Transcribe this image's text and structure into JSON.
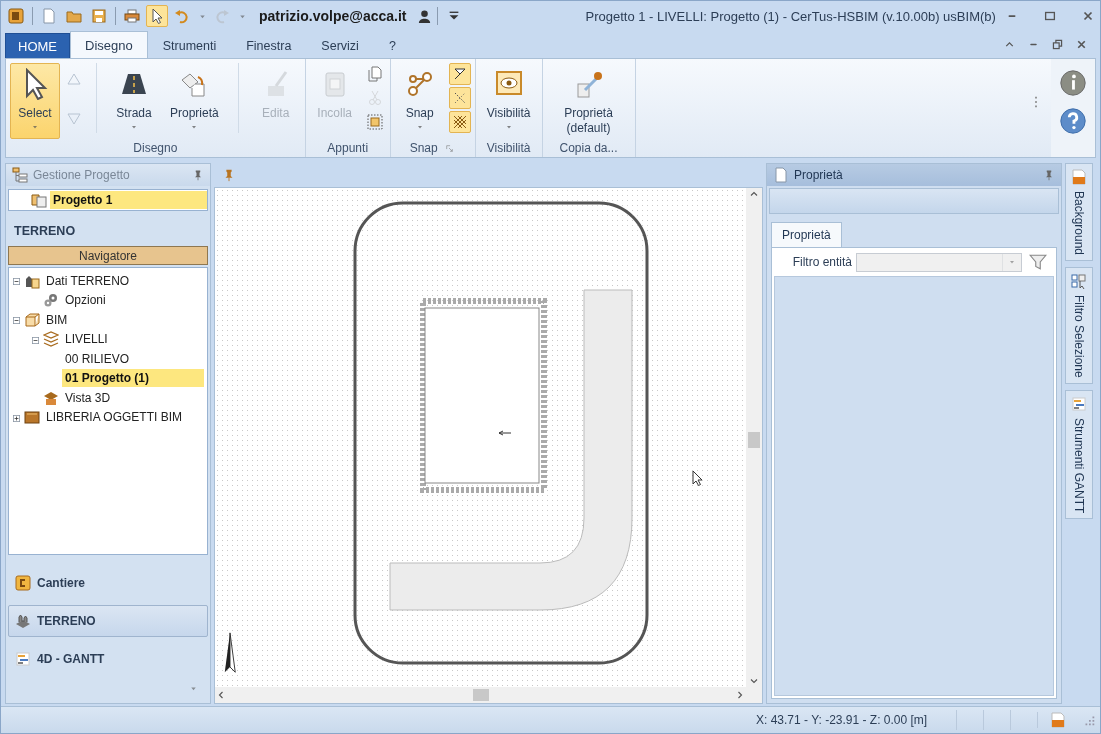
{
  "quick_access": {
    "buttons": [
      {
        "selected": false,
        "disabled": false
      },
      {
        "selected": false,
        "disabled": false
      },
      {
        "selected": false,
        "disabled": false
      },
      {
        "selected": false,
        "disabled": false
      },
      {
        "selected": false,
        "disabled": false
      },
      {
        "selected": true,
        "disabled": false
      },
      {
        "selected": false,
        "disabled": false
      },
      {
        "selected": false,
        "disabled": true
      }
    ],
    "user": "patrizio.volpe@acca.it"
  },
  "window": {
    "title": "Progetto 1 -  LIVELLI: Progetto (1) - CerTus-HSBIM (v.10.00b) usBIM(b)"
  },
  "tabs": [
    {
      "label": "HOME",
      "kind": "app",
      "selected": false
    },
    {
      "label": "Disegno",
      "kind": "tab",
      "selected": true
    },
    {
      "label": "Strumenti",
      "kind": "tab",
      "selected": false
    },
    {
      "label": "Finestra",
      "kind": "tab",
      "selected": false
    },
    {
      "label": "Servizi",
      "kind": "tab",
      "selected": false
    },
    {
      "label": "?",
      "kind": "tab",
      "selected": false
    }
  ],
  "ribbon": {
    "groups": [
      {
        "label": "Disegno",
        "launcher": false,
        "items": [
          {
            "kind": "large",
            "label": "Select",
            "selected": true,
            "disabled": false,
            "dropdown": true
          },
          {
            "kind": "stepper"
          },
          {
            "kind": "separator"
          },
          {
            "kind": "large",
            "label": "Strada",
            "selected": false,
            "disabled": false,
            "dropdown": true
          },
          {
            "kind": "large",
            "label": "Proprietà",
            "selected": false,
            "disabled": false,
            "dropdown": true
          },
          {
            "kind": "separator"
          },
          {
            "kind": "large",
            "label": "Edita",
            "selected": false,
            "disabled": true,
            "dropdown": false
          }
        ]
      },
      {
        "label": "Appunti",
        "launcher": false,
        "items": [
          {
            "kind": "large",
            "label": "Incolla",
            "selected": false,
            "disabled": true,
            "dropdown": false
          },
          {
            "kind": "stack",
            "buttons": [
              {
                "selected": false,
                "disabled": false
              },
              {
                "selected": false,
                "disabled": true
              },
              {
                "selected": false,
                "disabled": false
              }
            ]
          }
        ]
      },
      {
        "label": "Snap",
        "launcher": true,
        "items": [
          {
            "kind": "large",
            "label": "Snap",
            "selected": false,
            "disabled": false,
            "dropdown": true
          },
          {
            "kind": "stack",
            "buttons": [
              {
                "selected": true,
                "disabled": false
              },
              {
                "selected": true,
                "disabled": false
              },
              {
                "selected": true,
                "disabled": false
              }
            ]
          }
        ]
      },
      {
        "label": "Visibilità",
        "launcher": false,
        "items": [
          {
            "kind": "large",
            "label": "Visibilità",
            "selected": false,
            "disabled": false,
            "dropdown": true
          }
        ]
      },
      {
        "label": "Copia da...",
        "launcher": false,
        "items": [
          {
            "kind": "large",
            "label": "Proprietà (default)",
            "selected": false,
            "disabled": false,
            "dropdown": false
          }
        ]
      }
    ]
  },
  "project_panel": {
    "title": "Gestione Progetto",
    "project": {
      "label": "Progetto 1",
      "selected": true
    },
    "section": "TERRENO",
    "navigator": "Navigatore",
    "tree": [
      {
        "label": "Dati TERRENO",
        "expanded": true,
        "selected": false,
        "children": [
          {
            "label": "Opzioni",
            "selected": false
          }
        ]
      },
      {
        "label": "BIM",
        "expanded": true,
        "selected": false,
        "children": [
          {
            "label": "LIVELLI",
            "expanded": true,
            "selected": false,
            "children": [
              {
                "label": "00 RILIEVO",
                "selected": false
              },
              {
                "label": "01 Progetto (1)",
                "selected": true
              }
            ]
          },
          {
            "label": "Vista 3D",
            "selected": false
          }
        ]
      },
      {
        "label": "LIBRERIA OGGETTI BIM",
        "expanded": false,
        "selected": false
      }
    ],
    "modules": [
      {
        "label": "Cantiere",
        "selected": false
      },
      {
        "label": "TERRENO",
        "selected": true
      },
      {
        "label": "4D - GANTT",
        "selected": false
      }
    ]
  },
  "properties_panel": {
    "title": "Proprietà",
    "tabs": [
      {
        "label": "Proprietà",
        "selected": true
      }
    ],
    "filter": {
      "label": "Filtro entità",
      "disabled": true
    }
  },
  "side_tabs": [
    {
      "label": "Background"
    },
    {
      "label": "Filtro Selezione"
    },
    {
      "label": "Strumenti GANTT"
    }
  ],
  "status_bar": {
    "coordinates": "X: 43.71 - Y: -23.91 - Z: 0.00 [m]"
  }
}
